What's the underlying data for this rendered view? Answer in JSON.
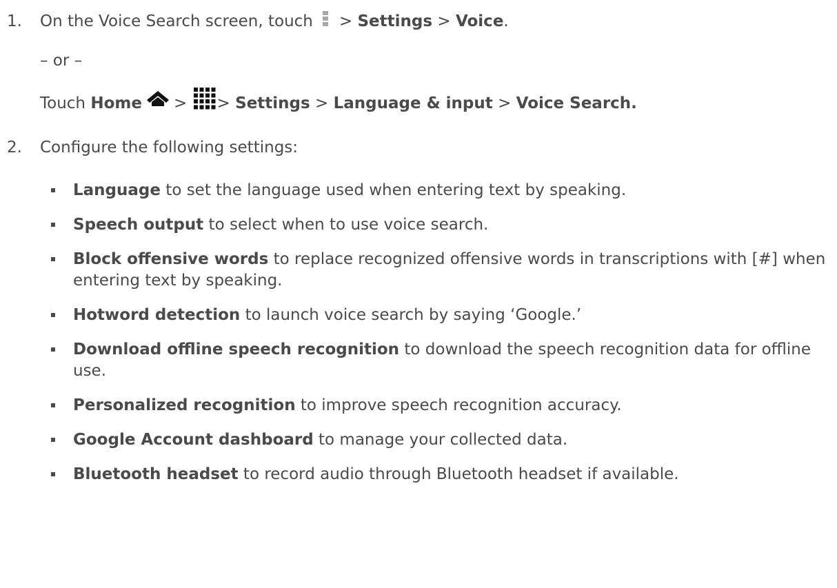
{
  "step1": {
    "number": "1.",
    "text_a": "On the Voice Search screen, touch",
    "sep1": ">",
    "settings": "Settings",
    "sep2": ">",
    "voice": "Voice",
    "end": "."
  },
  "or_text": "– or –",
  "alt": {
    "touch": "Touch",
    "home": "Home",
    "sep1": ">",
    "sep2": ">",
    "settings": "Settings",
    "sep3": ">",
    "language_input": "Language & input",
    "sep4": ">",
    "voice_search": "Voice Search."
  },
  "step2": {
    "number": "2.",
    "text": "Configure the following settings:"
  },
  "settings_list": [
    {
      "term": "Language",
      "desc": " to set the language used when entering text by speaking."
    },
    {
      "term": "Speech output",
      "desc": " to select when to use voice search."
    },
    {
      "term": "Block offensive words",
      "desc": " to replace recognized offensive words in transcriptions with [#] when entering text by speaking."
    },
    {
      "term": "Hotword detection",
      "desc": " to launch voice search by saying ‘Google.’"
    },
    {
      "term": "Download offline speech recognition",
      "desc": " to download the speech recognition data for offline use."
    },
    {
      "term": "Personalized recognition",
      "desc": " to improve speech recognition accuracy."
    },
    {
      "term": "Google Account dashboard",
      "desc": " to manage your collected data."
    },
    {
      "term": "Bluetooth headset",
      "desc": " to record audio through Bluetooth headset if available."
    }
  ],
  "icons": {
    "menu": "menu-icon",
    "home": "home-icon",
    "apps": "apps-grid-icon"
  },
  "colors": {
    "text": "#4a4a4a",
    "icon_gray": "#a8a8a8",
    "icon_dark": "#111111"
  }
}
